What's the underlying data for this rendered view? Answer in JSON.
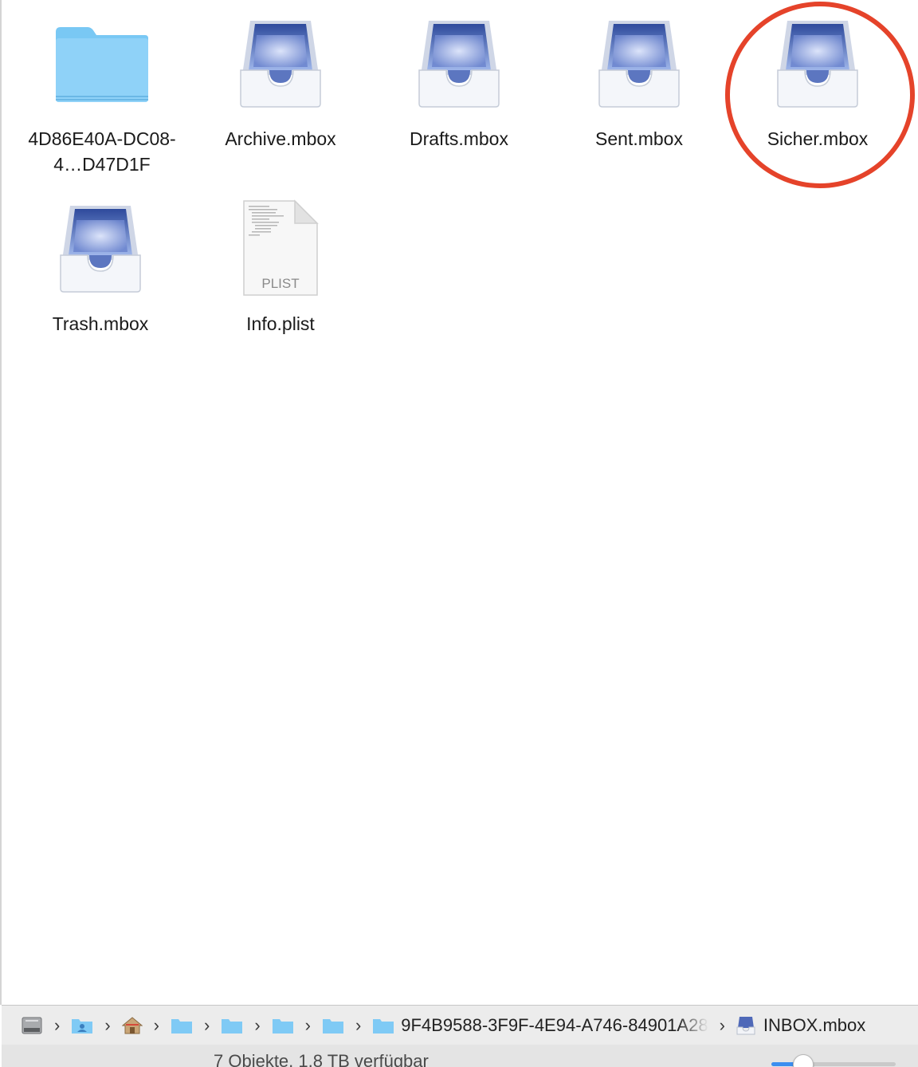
{
  "files": [
    {
      "name": "4D86E40A-DC08-4…D47D1F",
      "icon": "folder-icon"
    },
    {
      "name": "Archive.mbox",
      "icon": "mailbox-icon"
    },
    {
      "name": "Drafts.mbox",
      "icon": "mailbox-icon"
    },
    {
      "name": "Sent.mbox",
      "icon": "mailbox-icon"
    },
    {
      "name": "Sicher.mbox",
      "icon": "mailbox-icon"
    },
    {
      "name": "Trash.mbox",
      "icon": "mailbox-icon"
    },
    {
      "name": "Info.plist",
      "icon": "plist-file-icon",
      "badge": "PLIST"
    }
  ],
  "pathbar": {
    "segments": [
      {
        "icon": "hard-drive-icon"
      },
      {
        "icon": "user-folder-icon"
      },
      {
        "icon": "home-icon"
      },
      {
        "icon": "folder-icon"
      },
      {
        "icon": "folder-icon"
      },
      {
        "icon": "folder-icon"
      },
      {
        "icon": "folder-icon"
      },
      {
        "icon": "folder-icon",
        "label": "9F4B9588-3F9F-4E94-A746-84901A28"
      },
      {
        "icon": "mailbox-small-icon",
        "label": "INBOX.mbox"
      }
    ],
    "separator": "›"
  },
  "status": {
    "text": "7 Objekte, 1,8 TB verfügbar",
    "zoom_level": 0.25
  },
  "colors": {
    "highlight": "#e5432a",
    "folder": "#6cc2f5",
    "accent": "#3b8ef0"
  }
}
